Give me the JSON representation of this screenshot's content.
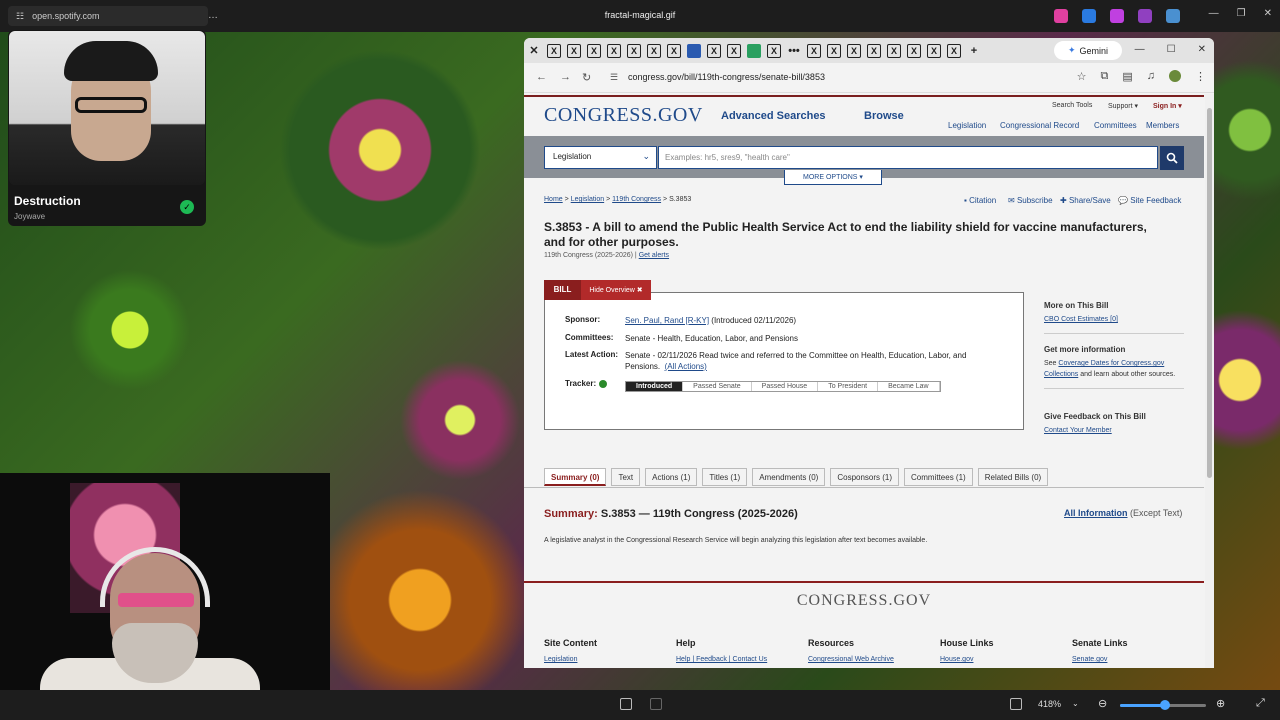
{
  "taskbar": {
    "url_pill": "open.spotify.com",
    "window_title": "fractal-magical.gif",
    "menu_dots": "…"
  },
  "spotify_overlay": {
    "track": "Destruction",
    "artist": "Joywave"
  },
  "viewer": {
    "zoom": "418%"
  },
  "browser": {
    "assistant_label": "Gemini",
    "address": "congress.gov/bill/119th-congress/senate-bill/3853"
  },
  "site": {
    "logo": "CONGRESS.GOV",
    "main_nav": [
      "Advanced Searches",
      "Browse"
    ],
    "util_nav": [
      "Search Tools",
      "Support ▾",
      "Sign In ▾"
    ],
    "section_nav": [
      "Legislation",
      "Congressional Record",
      "Committees",
      "Members"
    ],
    "search": {
      "scope": "Legislation",
      "placeholder": "Examples: hr5, sres9, \"health care\"",
      "more_options": "MORE OPTIONS ▾"
    }
  },
  "breadcrumb": {
    "items": [
      "Home",
      "Legislation",
      "119th Congress"
    ],
    "current": "S.3853",
    "separator": ">"
  },
  "page_tools": [
    "Citation",
    "Subscribe",
    "Share/Save",
    "Site Feedback"
  ],
  "bill": {
    "title": "S.3853 - A bill to amend the Public Health Service Act to end the liability shield for vaccine manufacturers, and for other purposes.",
    "congress": "119th Congress (2025-2026) |",
    "get_alerts": "Get alerts",
    "tab_label": "BILL",
    "hide_overview": "Hide Overview ✖",
    "sponsor_label": "Sponsor:",
    "sponsor_name": "Sen. Paul, Rand [R-KY]",
    "sponsor_intro": "(Introduced 02/11/2026)",
    "committees_label": "Committees:",
    "committees_value": "Senate - Health, Education, Labor, and Pensions",
    "latest_action_label": "Latest Action:",
    "latest_action_value": "Senate - 02/11/2026 Read twice and referred to the Committee on Health, Education, Labor, and Pensions.",
    "all_actions": "(All Actions)",
    "tracker_label": "Tracker:",
    "tracker_steps": [
      "Introduced",
      "Passed Senate",
      "Passed House",
      "To President",
      "Became Law"
    ],
    "tracker_current": 0
  },
  "sidebar": {
    "more_title": "More on This Bill",
    "cbo_link": "CBO Cost Estimates [0]",
    "info_title": "Get more information",
    "info_pre": "See",
    "info_link": "Coverage Dates for Congress.gov Collections",
    "info_post": "and learn about other sources.",
    "feedback_title": "Give Feedback on This Bill",
    "feedback_link": "Contact Your Member"
  },
  "tabs": [
    "Summary (0)",
    "Text",
    "Actions (1)",
    "Titles (1)",
    "Amendments (0)",
    "Cosponsors (1)",
    "Committees (1)",
    "Related Bills (0)"
  ],
  "summary": {
    "label": "Summary:",
    "heading": "S.3853 — 119th Congress (2025-2026)",
    "all_info": "All Information",
    "except_text": "(Except Text)",
    "text": "A legislative analyst in the Congressional Research Service will begin analyzing this legislation after text becomes available."
  },
  "footer": {
    "logo": "CONGRESS.GOV",
    "columns": [
      {
        "title": "Site Content",
        "link": "Legislation"
      },
      {
        "title": "Help",
        "link": "Help | Feedback | Contact Us"
      },
      {
        "title": "Resources",
        "link": "Congressional Web Archive"
      },
      {
        "title": "House Links",
        "link": "House.gov"
      },
      {
        "title": "Senate Links",
        "link": "Senate.gov"
      }
    ]
  }
}
